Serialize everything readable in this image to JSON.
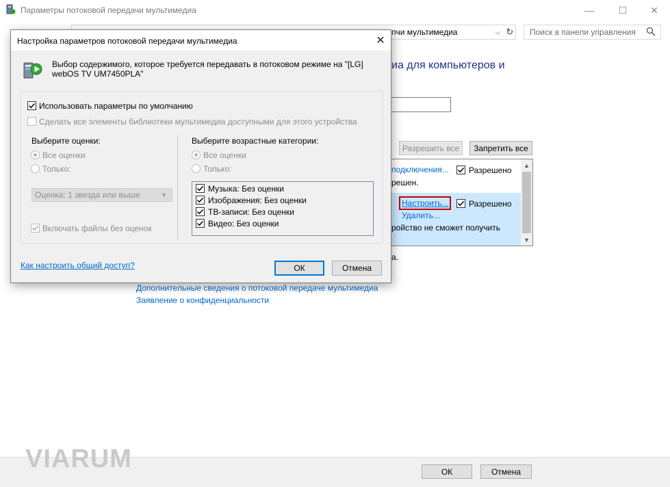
{
  "window": {
    "title": "Параметры потоковой передачи мультимедиа",
    "address_text": "пчи мультимедиа",
    "search_placeholder": "Поиск в панели управления",
    "heading_fragment": "иа для компьютеров и",
    "allow_all_label": "Разрешить все",
    "block_all_label": "Запретить все",
    "device_list": {
      "row1_link": "подключения...",
      "row1_status": "Разрешено",
      "row1_sub": "решен.",
      "row2_configure": "Настроить...",
      "row2_status": "Разрешено",
      "row2_delete": "Удалить...",
      "row2_sub": "ройство не сможет получить"
    },
    "fragment_a": "а.",
    "links": {
      "more_info": "Дополнительные сведения о потоковой передаче мультимедиа",
      "privacy": "Заявление о конфиденциальности"
    },
    "ok_label": "ОК",
    "cancel_label": "Отмена"
  },
  "dialog": {
    "title": "Настройка параметров потоковой передачи мультимедиа",
    "description": "Выбор содержимого, которое требуется передавать в потоковом режиме на \"[LG] webOS TV UM7450PLA\"",
    "use_defaults": "Использовать параметры по умолчанию",
    "make_all_available": "Сделать все элементы библиотеки мультимедиа доступными для этого устройства",
    "ratings": {
      "heading": "Выберите оценки:",
      "all": "Все оценки",
      "only": "Только:",
      "combo_value": "Оценка: 1 звезда или выше",
      "include_unrated": "Включать файлы без оценок"
    },
    "parental": {
      "heading": "Выберите возрастные категории:",
      "all": "Все оценки",
      "only": "Только:",
      "items": [
        "Музыка: Без оценки",
        "Изображения: Без оценки",
        "ТВ-записи: Без оценки",
        "Видео: Без оценки"
      ]
    },
    "help_link": "Как настроить общий доступ?",
    "ok_label": "ОК",
    "cancel_label": "Отмена"
  },
  "watermark": "VIARUM",
  "colors": {
    "link": "#0066cc",
    "heading": "#1e3287",
    "selection": "#cce8ff",
    "highlight_box": "#c00000"
  }
}
